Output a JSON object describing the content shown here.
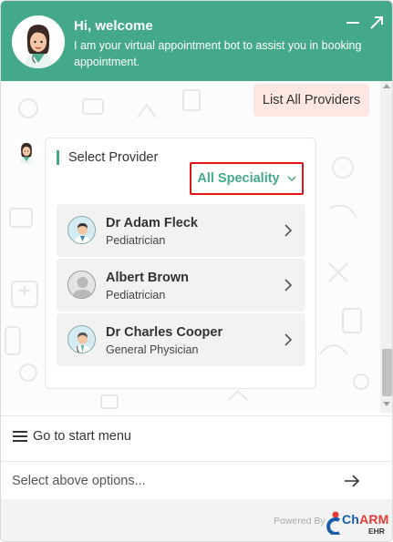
{
  "header": {
    "title": "Hi, welcome",
    "subtitle": "I am your virtual appointment bot to assist you in booking appointment.",
    "minimize_icon": "minus-icon",
    "expand_icon": "expand-arrow-icon",
    "bg_color": "#44a98a"
  },
  "chat": {
    "user_message": "List All Providers",
    "card": {
      "title": "Select Provider",
      "filter_label": "All Speciality",
      "providers": [
        {
          "name": "Dr Adam Fleck",
          "specialty": "Pediatrician"
        },
        {
          "name": "Albert Brown",
          "specialty": "Pediatrician"
        },
        {
          "name": "Dr Charles Cooper",
          "specialty": "General Physician"
        }
      ]
    }
  },
  "bottom": {
    "start_menu_label": "Go to start menu",
    "input_placeholder": "Select above options...",
    "powered_by": "Powered By",
    "logo_brand_part1": "Ch",
    "logo_brand_part2": "ARM",
    "logo_sub": "EHR"
  },
  "colors": {
    "accent": "#44a98a",
    "highlight_border": "#e01515",
    "user_bubble": "#fde7e3",
    "logo_blue": "#1a5ca8",
    "logo_red": "#e53935"
  }
}
